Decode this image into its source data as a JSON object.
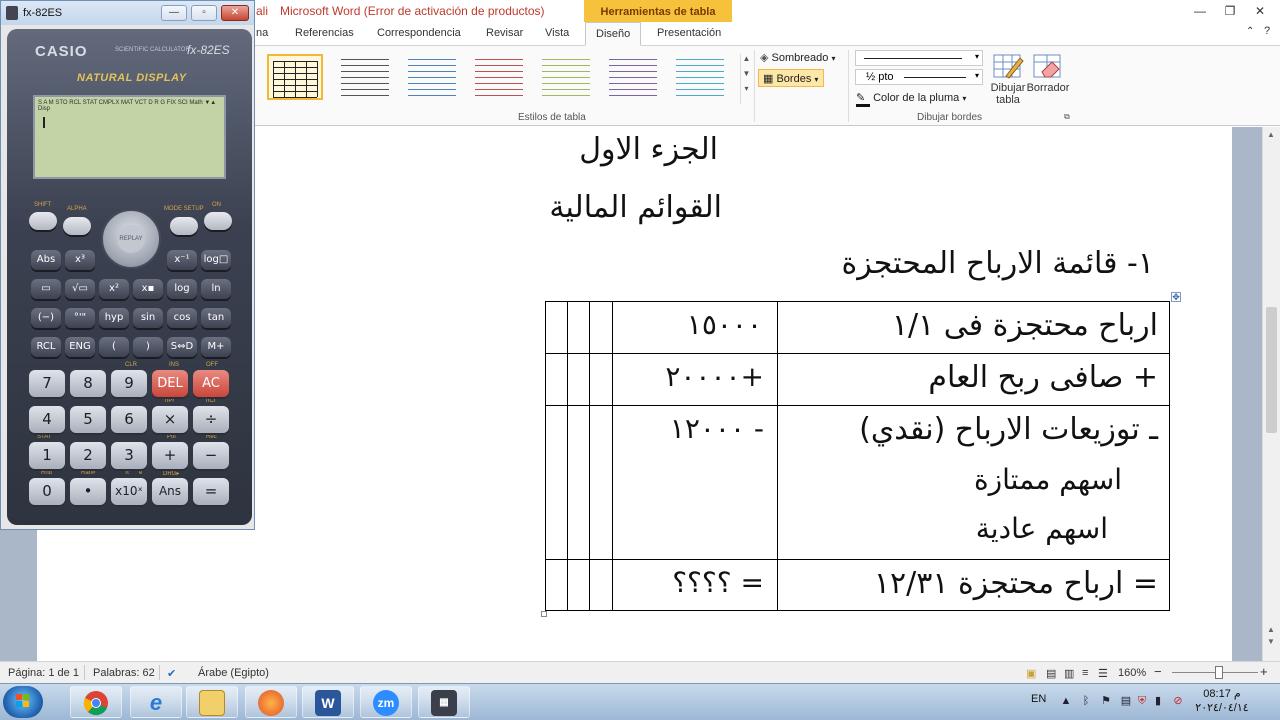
{
  "word": {
    "title_prefix": "ali",
    "title": "Microsoft Word (Error de activación de productos)",
    "contextual_tab": "Herramientas de tabla",
    "window_buttons": {
      "minimize": "—",
      "restore": "❐",
      "close": "✕"
    },
    "tabs": [
      "na",
      "Referencias",
      "Correspondencia",
      "Revisar",
      "Vista",
      "Diseño",
      "Presentación"
    ],
    "active_tab": "Diseño",
    "ribbon": {
      "table_styles_group": "Estilos de tabla",
      "draw_borders_group": "Dibujar bordes",
      "sombreado": "Sombreado",
      "bordes": "Bordes",
      "line_weight": "½ pto",
      "pen_color": "Color de la pluma",
      "draw_table": "Dibujar tabla",
      "eraser": "Borrador",
      "style_colors": [
        "#222222",
        "#555555",
        "#4f81bd",
        "#c0504d",
        "#9bbb59",
        "#8064a2",
        "#4bacc6"
      ]
    }
  },
  "document": {
    "part_heading": "الجزء الاول",
    "section_heading": "القوائم المالية",
    "statement_title": "١- قائمة الارباح المحتجزة",
    "rows": [
      {
        "label": "ارباح محتجزة فى ١/١",
        "amount": "١٥٠٠٠"
      },
      {
        "label": "+ صافى ربح العام",
        "amount": "+٢٠٠٠٠"
      },
      {
        "label": "ـ توزيعات الارباح (نقدي)",
        "amount": "- ١٢٠٠٠",
        "sub": [
          "اسهم ممتازة",
          "اسهم عادية"
        ]
      },
      {
        "label": "= ارباح محتجزة ١٢/٣١",
        "amount": "= ؟؟؟؟"
      }
    ]
  },
  "statusbar": {
    "page": "Página: 1 de 1",
    "words": "Palabras: 62",
    "language": "Árabe (Egipto)",
    "zoom": "160%",
    "zoom_minus": "−",
    "zoom_plus": "+",
    "zoom_fraction": 0.55
  },
  "taskbar": {
    "apps": [
      "chrome",
      "internet-explorer",
      "file-explorer",
      "firefox",
      "word",
      "zoom",
      "calculator"
    ],
    "word_glyph": "W",
    "zoom_glyph": "zm",
    "lang": "EN",
    "time": "08:17 م",
    "date": "٢٠٢٤/٠٤/١٤"
  },
  "calculator": {
    "title": "fx-82ES",
    "brand": "CASIO",
    "subtitle": "SCIENTIFIC CALCULATOR",
    "model": "fx-82ES",
    "tagline": "NATURAL DISPLAY",
    "lcd_status": "S A M STO RCL STAT CMPLX MAT VCT D R G FIX SCI Math ▼▲ Disp",
    "top_labels": {
      "shift": "SHIFT",
      "alpha": "ALPHA",
      "replay": "REPLAY",
      "mode": "MODE SETUP",
      "on": "ON"
    },
    "row_fn1": [
      "Abs",
      "x³",
      "x⁻¹",
      "log□"
    ],
    "row_fn2": [
      "▭",
      "√▭",
      "x²",
      "x▪",
      "log",
      "ln"
    ],
    "row_fn3": [
      "(−)",
      "°'\"",
      "hyp",
      "sin",
      "cos",
      "tan"
    ],
    "row_fn4": [
      "RCL",
      "ENG",
      "(",
      ")",
      "S⇔D",
      "M+"
    ],
    "row_num1": [
      "7",
      "8",
      "9",
      "DEL",
      "AC"
    ],
    "row_num2": [
      "4",
      "5",
      "6",
      "×",
      "÷"
    ],
    "row_num3": [
      "1",
      "2",
      "3",
      "+",
      "−"
    ],
    "row_num4": [
      "0",
      "•",
      "x10ˣ",
      "Ans",
      "="
    ],
    "sub_labels": [
      "CLR",
      "INS",
      "OFF",
      "nPr",
      "nCr",
      "STAT",
      "Pol",
      "Rec",
      "Rnd",
      "Ran#",
      "DRG▸",
      "π",
      "e"
    ]
  }
}
